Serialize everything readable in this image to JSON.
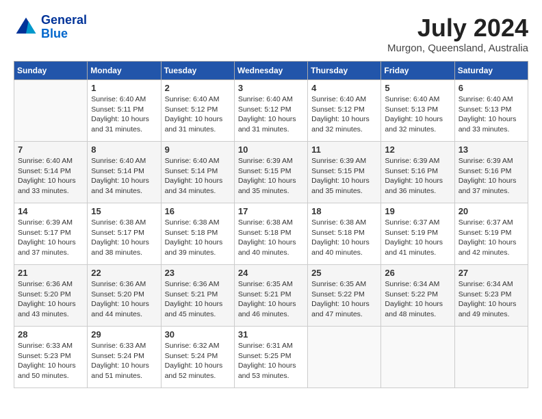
{
  "header": {
    "logo_line1": "General",
    "logo_line2": "Blue",
    "month_year": "July 2024",
    "location": "Murgon, Queensland, Australia"
  },
  "days_of_week": [
    "Sunday",
    "Monday",
    "Tuesday",
    "Wednesday",
    "Thursday",
    "Friday",
    "Saturday"
  ],
  "weeks": [
    [
      {
        "num": "",
        "empty": true
      },
      {
        "num": "1",
        "sunrise": "6:40 AM",
        "sunset": "5:11 PM",
        "daylight": "10 hours and 31 minutes."
      },
      {
        "num": "2",
        "sunrise": "6:40 AM",
        "sunset": "5:12 PM",
        "daylight": "10 hours and 31 minutes."
      },
      {
        "num": "3",
        "sunrise": "6:40 AM",
        "sunset": "5:12 PM",
        "daylight": "10 hours and 31 minutes."
      },
      {
        "num": "4",
        "sunrise": "6:40 AM",
        "sunset": "5:12 PM",
        "daylight": "10 hours and 32 minutes."
      },
      {
        "num": "5",
        "sunrise": "6:40 AM",
        "sunset": "5:13 PM",
        "daylight": "10 hours and 32 minutes."
      },
      {
        "num": "6",
        "sunrise": "6:40 AM",
        "sunset": "5:13 PM",
        "daylight": "10 hours and 33 minutes."
      }
    ],
    [
      {
        "num": "7",
        "sunrise": "6:40 AM",
        "sunset": "5:14 PM",
        "daylight": "10 hours and 33 minutes."
      },
      {
        "num": "8",
        "sunrise": "6:40 AM",
        "sunset": "5:14 PM",
        "daylight": "10 hours and 34 minutes."
      },
      {
        "num": "9",
        "sunrise": "6:40 AM",
        "sunset": "5:14 PM",
        "daylight": "10 hours and 34 minutes."
      },
      {
        "num": "10",
        "sunrise": "6:39 AM",
        "sunset": "5:15 PM",
        "daylight": "10 hours and 35 minutes."
      },
      {
        "num": "11",
        "sunrise": "6:39 AM",
        "sunset": "5:15 PM",
        "daylight": "10 hours and 35 minutes."
      },
      {
        "num": "12",
        "sunrise": "6:39 AM",
        "sunset": "5:16 PM",
        "daylight": "10 hours and 36 minutes."
      },
      {
        "num": "13",
        "sunrise": "6:39 AM",
        "sunset": "5:16 PM",
        "daylight": "10 hours and 37 minutes."
      }
    ],
    [
      {
        "num": "14",
        "sunrise": "6:39 AM",
        "sunset": "5:17 PM",
        "daylight": "10 hours and 37 minutes."
      },
      {
        "num": "15",
        "sunrise": "6:38 AM",
        "sunset": "5:17 PM",
        "daylight": "10 hours and 38 minutes."
      },
      {
        "num": "16",
        "sunrise": "6:38 AM",
        "sunset": "5:18 PM",
        "daylight": "10 hours and 39 minutes."
      },
      {
        "num": "17",
        "sunrise": "6:38 AM",
        "sunset": "5:18 PM",
        "daylight": "10 hours and 40 minutes."
      },
      {
        "num": "18",
        "sunrise": "6:38 AM",
        "sunset": "5:18 PM",
        "daylight": "10 hours and 40 minutes."
      },
      {
        "num": "19",
        "sunrise": "6:37 AM",
        "sunset": "5:19 PM",
        "daylight": "10 hours and 41 minutes."
      },
      {
        "num": "20",
        "sunrise": "6:37 AM",
        "sunset": "5:19 PM",
        "daylight": "10 hours and 42 minutes."
      }
    ],
    [
      {
        "num": "21",
        "sunrise": "6:36 AM",
        "sunset": "5:20 PM",
        "daylight": "10 hours and 43 minutes."
      },
      {
        "num": "22",
        "sunrise": "6:36 AM",
        "sunset": "5:20 PM",
        "daylight": "10 hours and 44 minutes."
      },
      {
        "num": "23",
        "sunrise": "6:36 AM",
        "sunset": "5:21 PM",
        "daylight": "10 hours and 45 minutes."
      },
      {
        "num": "24",
        "sunrise": "6:35 AM",
        "sunset": "5:21 PM",
        "daylight": "10 hours and 46 minutes."
      },
      {
        "num": "25",
        "sunrise": "6:35 AM",
        "sunset": "5:22 PM",
        "daylight": "10 hours and 47 minutes."
      },
      {
        "num": "26",
        "sunrise": "6:34 AM",
        "sunset": "5:22 PM",
        "daylight": "10 hours and 48 minutes."
      },
      {
        "num": "27",
        "sunrise": "6:34 AM",
        "sunset": "5:23 PM",
        "daylight": "10 hours and 49 minutes."
      }
    ],
    [
      {
        "num": "28",
        "sunrise": "6:33 AM",
        "sunset": "5:23 PM",
        "daylight": "10 hours and 50 minutes."
      },
      {
        "num": "29",
        "sunrise": "6:33 AM",
        "sunset": "5:24 PM",
        "daylight": "10 hours and 51 minutes."
      },
      {
        "num": "30",
        "sunrise": "6:32 AM",
        "sunset": "5:24 PM",
        "daylight": "10 hours and 52 minutes."
      },
      {
        "num": "31",
        "sunrise": "6:31 AM",
        "sunset": "5:25 PM",
        "daylight": "10 hours and 53 minutes."
      },
      {
        "num": "",
        "empty": true
      },
      {
        "num": "",
        "empty": true
      },
      {
        "num": "",
        "empty": true
      }
    ]
  ]
}
